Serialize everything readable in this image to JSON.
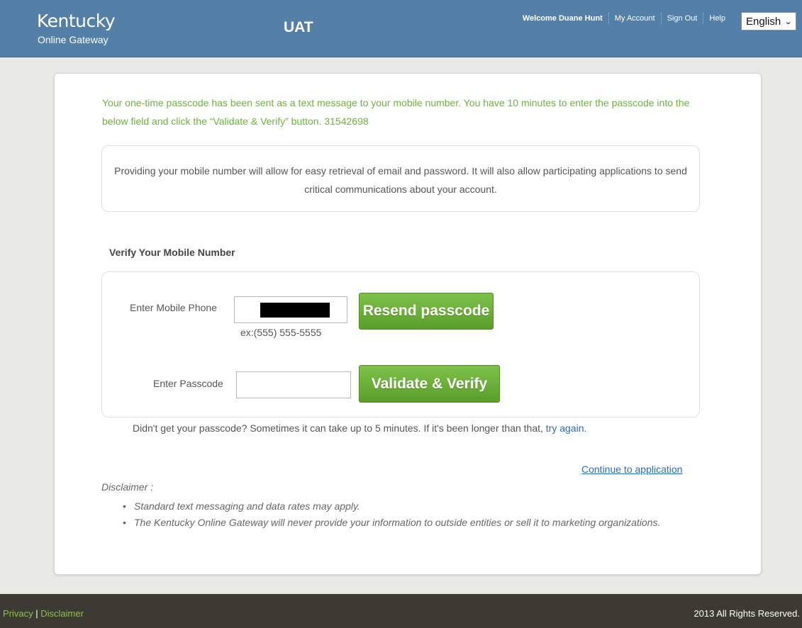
{
  "header": {
    "brand_title": "Kentucky",
    "brand_subtitle": "Online Gateway",
    "environment": "UAT",
    "welcome": "Welcome Duane Hunt",
    "nav": {
      "my_account": "My Account",
      "sign_out": "Sign Out",
      "help": "Help"
    },
    "language": "English"
  },
  "main": {
    "notice": "Your one-time passcode has been sent as a text message to your mobile number. You have 10 minutes to enter the passcode into the below field and click the “Validate & Verify” button. 31542698",
    "info": "Providing your mobile number will allow for easy retrieval of email and password. It will also allow participating applications to send critical communications about your account.",
    "section_title": "Verify Your Mobile Number",
    "phone_label": "Enter Mobile Phone",
    "phone_hint": "ex:(555) 555-5555",
    "resend_button": "Resend passcode",
    "passcode_label": "Enter Passcode",
    "passcode_value": "",
    "validate_button": "Validate & Verify",
    "retry_text": "Didn't get your passcode? Sometimes it can take up to 5 minutes. If it's been longer than that,",
    "retry_link": "try again.",
    "continue_link": "Continue to application",
    "disclaimer_title": "Disclaimer :",
    "disclaimer_items": [
      "Standard text messaging and data rates may apply.",
      "The Kentucky Online Gateway will never provide your information to outside entities or sell it to marketing organizations."
    ]
  },
  "footer": {
    "privacy": "Privacy",
    "separator": "|",
    "disclaimer": "Disclaimer",
    "copyright": "2013 All Rights Reserved."
  },
  "colors": {
    "header_bg": "#5480a8",
    "notice_green": "#6cb33f",
    "button_green": "#6aae3a",
    "link_blue": "#2a6db0",
    "footer_bg": "#3b3b34",
    "footer_link": "#8fc04f"
  }
}
